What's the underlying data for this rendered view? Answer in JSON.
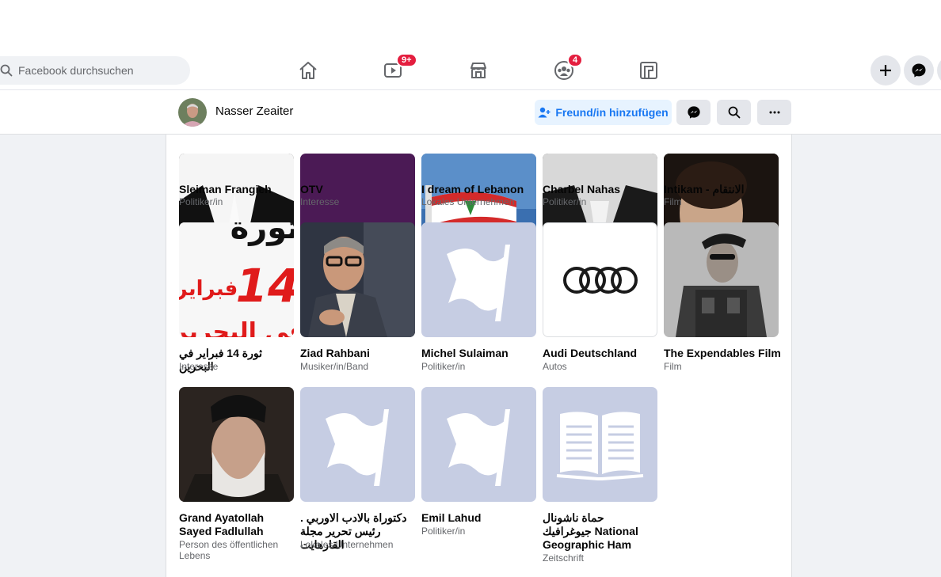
{
  "nav": {
    "search_placeholder": "Facebook durchsuchen",
    "watch_badge": "9+",
    "groups_badge": "4"
  },
  "profile": {
    "name": "Nasser Zeaiter",
    "add_friend_label": "Freund/in hinzufügen"
  },
  "pages": [
    {
      "name": "Sleiman Frangieh",
      "category": "Politiker/in"
    },
    {
      "name": "OTV",
      "category": "Interesse"
    },
    {
      "name": "I dream of Lebanon",
      "category": "Lokales Unternehmen"
    },
    {
      "name": "Charbel Nahas",
      "category": "Politiker/in"
    },
    {
      "name": "Intikam - الانتقام",
      "category": "Film"
    },
    {
      "name": "ثورة 14 فبراير في البحرين",
      "category": "Interesse",
      "image_text": [
        "ثورة",
        "14",
        "فبراير",
        "في البحرين"
      ]
    },
    {
      "name": "Ziad Rahbani",
      "category": "Musiker/in/Band"
    },
    {
      "name": "Michel Sulaiman",
      "category": "Politiker/in"
    },
    {
      "name": "Audi Deutschland",
      "category": "Autos"
    },
    {
      "name": "The Expendables Film",
      "category": "Film"
    },
    {
      "name": "Grand Ayatollah Sayed Fadlullah",
      "category": "Person des öffentlichen Lebens"
    },
    {
      "name": "دكتوراة بالادب الاوربي . رئيس تحرير مجلة القارهايت",
      "category": "Lokales Unternehmen"
    },
    {
      "name": "Emil Lahud",
      "category": "Politiker/in"
    },
    {
      "name": "حماة ناشونال جيوغرافيك National Geographic Ham",
      "category": "Zeitschrift"
    }
  ],
  "colors": {
    "brand_blue": "#1877f2",
    "badge_red": "#e41e3f",
    "placeholder_tile": "#c6cde3",
    "page_bg": "#f0f2f5"
  }
}
